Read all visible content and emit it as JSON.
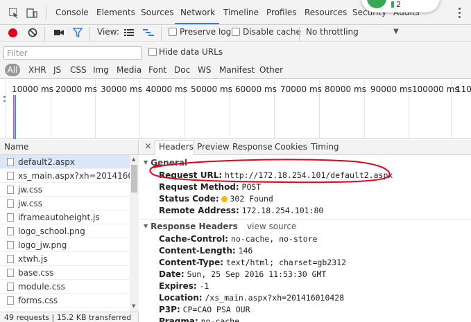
{
  "tabbar": {
    "tabs": [
      "Console",
      "Elements",
      "Sources",
      "Network",
      "Timeline",
      "Profiles",
      "Resources",
      "Security",
      "Audits"
    ],
    "active_tab": "Network",
    "badge_count": "2"
  },
  "toolbar": {
    "view_label": "View:",
    "preserve_log": "Preserve log",
    "disable_cache": "Disable cache",
    "throttling": "No throttling"
  },
  "filter": {
    "placeholder": "Filter",
    "hide_data_urls": "Hide data URLs",
    "types": [
      "All",
      "XHR",
      "JS",
      "CSS",
      "Img",
      "Media",
      "Font",
      "Doc",
      "WS",
      "Manifest",
      "Other"
    ]
  },
  "timeline": {
    "ticks": [
      "10000 ms",
      "20000 ms",
      "30000 ms",
      "40000 ms",
      "50000 ms",
      "60000 ms",
      "70000 ms",
      "80000 ms",
      "90000 ms",
      "100000 ms",
      "1100"
    ]
  },
  "requests": {
    "header": "Name",
    "items": [
      "default2.aspx",
      "xs_main.aspx?xh=201416010...",
      "jw.css",
      "jw.css",
      "iframeautoheight.js",
      "logo_school.png",
      "logo_jw.png",
      "xtwh.js",
      "base.css",
      "module.css",
      "forms.css"
    ],
    "selected_index": 0,
    "status": "49 requests | 15.2 KB transferred"
  },
  "detail": {
    "close": "×",
    "tabs": [
      "Headers",
      "Preview",
      "Response",
      "Cookies",
      "Timing"
    ],
    "active_tab": "Headers",
    "general": {
      "title": "General",
      "request_url_label": "Request URL:",
      "request_url": "http://172.18.254.101/default2.aspx",
      "request_method_label": "Request Method:",
      "request_method": "POST",
      "status_code_label": "Status Code:",
      "status_code": "302 Found",
      "remote_address_label": "Remote Address:",
      "remote_address": "172.18.254.101:80"
    },
    "response_headers": {
      "title": "Response Headers",
      "view_source": "view source",
      "rows": [
        {
          "k": "Cache-Control:",
          "v": "no-cache, no-store"
        },
        {
          "k": "Content-Length:",
          "v": "146"
        },
        {
          "k": "Content-Type:",
          "v": "text/html; charset=gb2312"
        },
        {
          "k": "Date:",
          "v": "Sun, 25 Sep 2016 11:53:30 GMT"
        },
        {
          "k": "Expires:",
          "v": "-1"
        },
        {
          "k": "Location:",
          "v": "/xs_main.aspx?xh=201416010428"
        },
        {
          "k": "P3P:",
          "v": "CP=CAO PSA OUR"
        },
        {
          "k": "Pragma:",
          "v": "no-cache"
        }
      ]
    }
  },
  "colors": {
    "accent": "#3879d9",
    "record": "#e0001b",
    "annotation": "#e8001c",
    "status_dot": "#f5b800"
  }
}
